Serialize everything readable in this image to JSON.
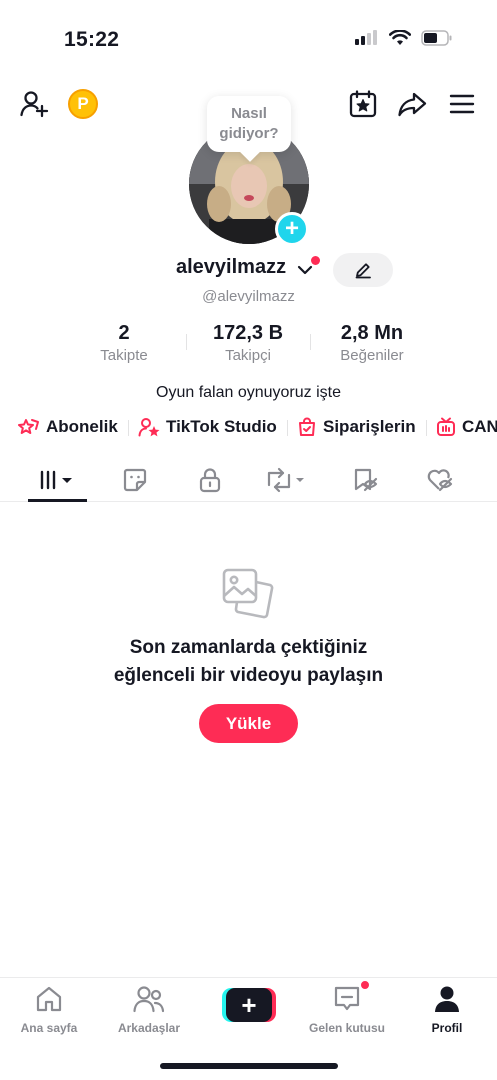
{
  "status_bar": {
    "time": "15:22"
  },
  "profile": {
    "bubble_text": "Nasıl gidiyor?",
    "username": "alevyilmazz",
    "handle": "@alevyilmazz",
    "bio": "Oyun falan oynuyoruz işte"
  },
  "stats": [
    {
      "value": "2",
      "label": "Takipte"
    },
    {
      "value": "172,3 B",
      "label": "Takipçi"
    },
    {
      "value": "2,8 Mn",
      "label": "Beğeniler"
    }
  ],
  "links": [
    {
      "label": "Abonelik",
      "icon": "subscription-icon"
    },
    {
      "label": "TikTok Studio",
      "icon": "studio-icon"
    },
    {
      "label": "Siparişlerin",
      "icon": "orders-bag-icon"
    },
    {
      "label": "CAN",
      "icon": "live-tv-icon"
    }
  ],
  "tabs": [
    {
      "icon": "videos-grid-icon",
      "active": true
    },
    {
      "icon": "sticker-icon"
    },
    {
      "icon": "lock-icon"
    },
    {
      "icon": "repost-icon"
    },
    {
      "icon": "favorites-hidden-icon"
    },
    {
      "icon": "liked-hidden-icon"
    }
  ],
  "empty_state": {
    "title_line1": "Son zamanlarda çektiğiniz",
    "title_line2": "eğlenceli bir videoyu paylaşın",
    "button": "Yükle"
  },
  "bottom_nav": [
    {
      "label": "Ana sayfa",
      "icon": "home-icon"
    },
    {
      "label": "Arkadaşlar",
      "icon": "friends-icon"
    },
    {
      "label": "",
      "icon": "create-plus-icon"
    },
    {
      "label": "Gelen kutusu",
      "icon": "inbox-icon"
    },
    {
      "label": "Profil",
      "icon": "profile-icon",
      "active": true
    }
  ],
  "colors": {
    "accent": "#FE2C55",
    "cyan": "#20D5EC",
    "text": "#161823",
    "muted": "#8a8b91",
    "coin": "#FFC107"
  }
}
